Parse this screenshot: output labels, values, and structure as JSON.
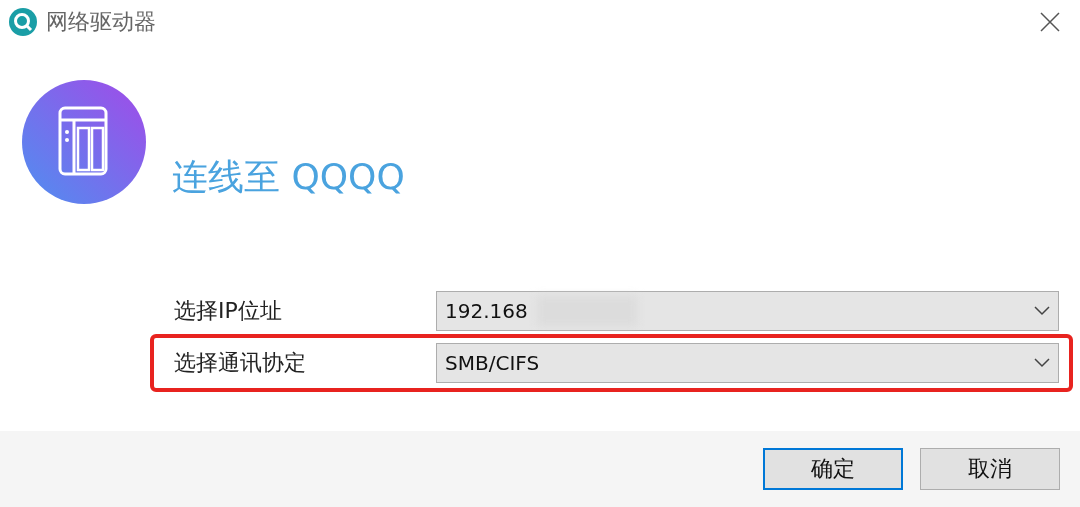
{
  "window": {
    "title": "网络驱动器"
  },
  "heading": "连线至 QQQQ",
  "fields": [
    {
      "label": "选择IP位址",
      "value": "192.168",
      "redacted": true,
      "highlighted": false
    },
    {
      "label": "选择通讯协定",
      "value": "SMB/CIFS",
      "redacted": false,
      "highlighted": true
    }
  ],
  "buttons": [
    {
      "label": "确定",
      "default": true
    },
    {
      "label": "取消",
      "default": false
    }
  ]
}
